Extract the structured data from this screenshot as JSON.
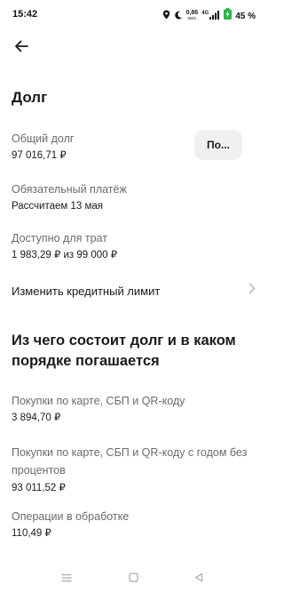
{
  "status_bar": {
    "time": "15:42",
    "net_speed_value": "0,86",
    "net_speed_unit": "КВ/S",
    "network_type": "4G",
    "battery_percent": "45 %",
    "icons": [
      "location-icon",
      "moon-icon",
      "signal-icon",
      "battery-icon"
    ]
  },
  "page": {
    "title": "Долг"
  },
  "debt": {
    "total_label": "Общий долг",
    "total_value": "97 016,71 ₽",
    "pay_button_label": "По...",
    "mandatory_label": "Обязательный платёж",
    "mandatory_value": "Рассчитаем 13 мая",
    "available_label": "Доступно для трат",
    "available_value": "1 983,29 ₽ из 99 000 ₽",
    "change_limit_label": "Изменить кредитный лимит"
  },
  "breakdown": {
    "title": "Из чего состоит долг и в каком порядке погашается",
    "items": [
      {
        "label": "Покупки по карте, СБП и QR-коду",
        "value": "3 894,70 ₽"
      },
      {
        "label": "Покупки по карте, СБП и QR-коду с годом без процентов",
        "value": "93 011,52 ₽"
      },
      {
        "label": "Операции в обработке",
        "value": "110,49 ₽"
      }
    ]
  },
  "colors": {
    "text_primary": "#1a1a1a",
    "text_secondary": "#6b6b6b",
    "button_bg": "#f0f0f3",
    "battery_green": "#2db34a",
    "chevron": "#b5b5b5"
  }
}
